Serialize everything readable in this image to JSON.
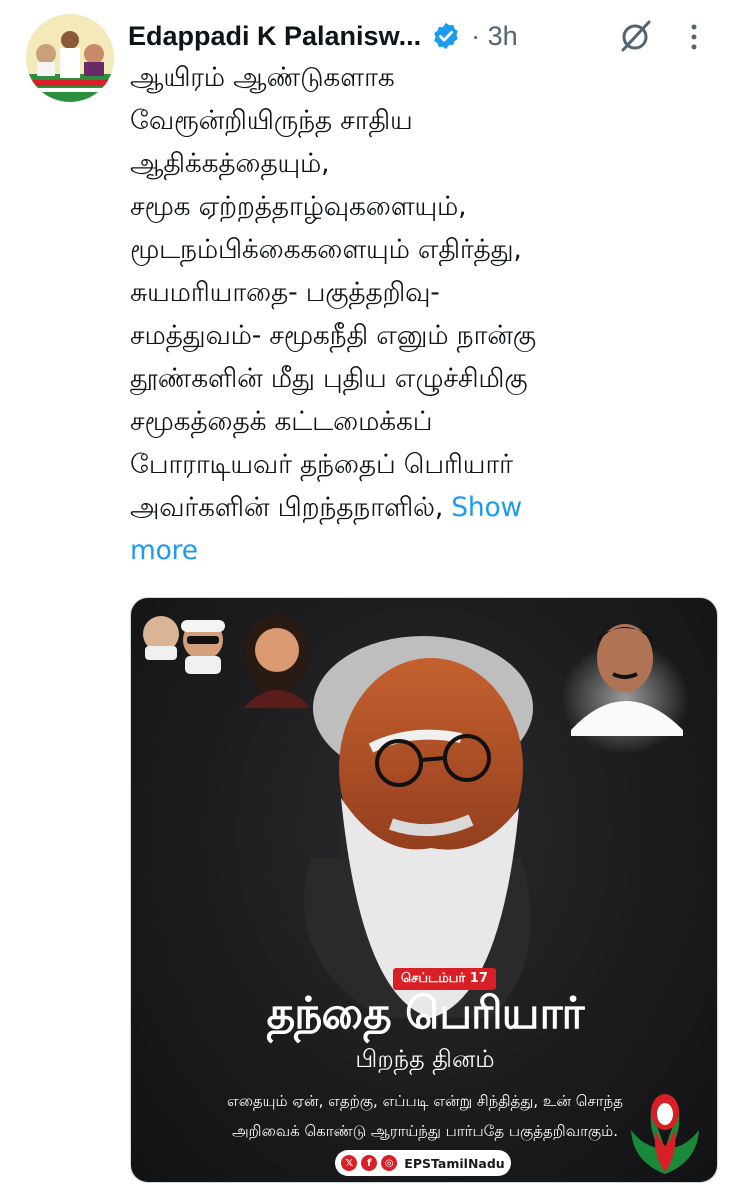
{
  "author": {
    "name": "Edappadi K Palanisw...",
    "verified": true,
    "time": "3h"
  },
  "icons": {
    "avatar": "avatar",
    "verified": "verified-badge-icon",
    "grok": "grok-icon",
    "more": "more-options-icon"
  },
  "tweet": {
    "lines": [
      "ஆயிரம் ஆண்டுகளாக",
      "வேரூன்றியிருந்த சாதிய",
      "ஆதிக்கத்தையும்,",
      "சமூக ஏற்றத்தாழ்வுகளையும்,",
      "மூடநம்பிக்கைகளையும் எதிர்த்து,",
      "சுயமரியாதை- பகுத்தறிவு-",
      "சமத்துவம்- சமூகநீதி எனும் நான்கு",
      "தூண்களின் மீது புதிய எழுச்சிமிகு",
      "சமூகத்தைக் கட்டமைக்கப்",
      "போராடியவர் தந்தைப் பெரியார்",
      "அவர்களின் பிறந்தநாளில்,"
    ],
    "show_more_part1": "Show",
    "show_more_part2": "more"
  },
  "poster": {
    "date_badge": "செப்டம்பர் 17",
    "title": "தந்தை பெரியார்",
    "subtitle": "பிறந்த தினம்",
    "quote_line1": "எதையும் ஏன், எதற்கு, எப்படி என்று சிந்தித்து, உன் சொந்த",
    "quote_line2": "அறிவைக் கொண்டு ஆராய்ந்து பார்பதே பகுத்தறிவாகும்.",
    "social_icons": [
      "x-icon",
      "facebook-icon",
      "instagram-icon"
    ],
    "handle": "EPSTamilNadu"
  },
  "colors": {
    "text": "#0f1419",
    "secondary": "#536471",
    "link": "#1d9bf0",
    "verified": "#1d9bf0",
    "poster_red": "#d81f26",
    "party_green": "#1a8a3a"
  }
}
